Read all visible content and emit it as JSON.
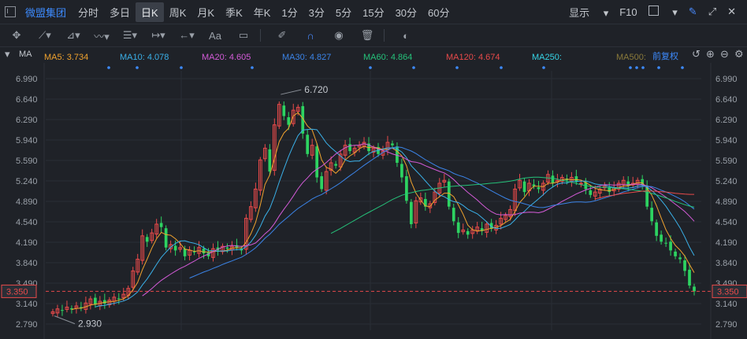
{
  "toolbar": {
    "stock_name": "微盟集团",
    "periods": [
      "分时",
      "多日",
      "日K",
      "周K",
      "月K",
      "季K",
      "年K",
      "1分",
      "3分",
      "5分",
      "15分",
      "30分",
      "60分"
    ],
    "active_period": "日K",
    "display_label": "显示",
    "f10_label": "F10"
  },
  "drawing_tools": [
    "move-icon",
    "line-icon",
    "ray-icon",
    "fib-icon",
    "wave-icon",
    "channel-icon",
    "range-icon",
    "arrow-icon",
    "text-icon",
    "note-icon",
    "eraser-icon",
    "magnet-icon",
    "eye-icon",
    "trash-icon",
    "toggle-icon"
  ],
  "text_tool_label": "Aa",
  "indicator_bar": {
    "name": "MA",
    "items": [
      {
        "label": "MA5: 3.734",
        "color": "#f0a22e"
      },
      {
        "label": "MA10: 4.078",
        "color": "#3ab0e8"
      },
      {
        "label": "MA20: 4.605",
        "color": "#d45bd8"
      },
      {
        "label": "MA30: 4.827",
        "color": "#3b84e8"
      },
      {
        "label": "MA60: 4.864",
        "color": "#25c27a"
      },
      {
        "label": "MA120: 4.674",
        "color": "#e84a4a"
      },
      {
        "label": "MA250:",
        "color": "#36d4e6"
      },
      {
        "label": "MA500:",
        "color": "#8a7a3a"
      }
    ],
    "adjust_label": "前复权"
  },
  "colors": {
    "up": "#e84a4a",
    "down": "#2dd361",
    "grid": "#2a2e36",
    "axis_text": "#9aa0a8",
    "current": "#e84a4a"
  },
  "chart_data": {
    "type": "candlestick",
    "ylim": [
      2.79,
      6.99
    ],
    "y_ticks": [
      2.79,
      3.14,
      3.49,
      3.84,
      4.19,
      4.54,
      4.89,
      5.24,
      5.59,
      5.94,
      6.29,
      6.64,
      6.99
    ],
    "y_tick_labels": [
      "2.790",
      "3.140",
      "3.490",
      "3.840",
      "4.190",
      "4.540",
      "4.890",
      "5.240",
      "5.590",
      "5.940",
      "6.290",
      "6.640",
      "6.990"
    ],
    "current_price": 3.35,
    "current_price_label": "3.350",
    "annotations": [
      {
        "text": "6.720",
        "value": 6.72
      },
      {
        "text": "2.930",
        "value": 2.93
      }
    ],
    "closes": [
      3.0,
      3.05,
      3.02,
      3.08,
      3.04,
      3.1,
      3.06,
      3.15,
      3.22,
      3.12,
      3.18,
      3.14,
      3.2,
      3.25,
      3.22,
      3.3,
      3.4,
      3.7,
      3.9,
      4.3,
      4.2,
      4.35,
      4.5,
      4.45,
      4.1,
      4.15,
      4.05,
      4.1,
      3.95,
      4.05,
      4.02,
      4.1,
      4.0,
      3.95,
      4.08,
      4.05,
      4.12,
      4.08,
      4.12,
      4.1,
      4.05,
      4.6,
      4.8,
      5.1,
      5.6,
      5.8,
      5.4,
      6.2,
      6.55,
      6.35,
      6.2,
      6.45,
      6.5,
      6.05,
      5.7,
      5.85,
      5.3,
      5.1,
      5.4,
      5.55,
      5.5,
      5.7,
      5.85,
      5.75,
      5.8,
      5.85,
      5.9,
      5.75,
      5.8,
      5.7,
      5.75,
      5.9,
      5.85,
      5.55,
      5.3,
      4.9,
      4.5,
      4.9,
      4.95,
      4.8,
      4.85,
      5.05,
      5.2,
      5.25,
      4.8,
      4.55,
      4.35,
      4.4,
      4.32,
      4.4,
      4.45,
      4.38,
      4.5,
      4.42,
      4.48,
      4.6,
      4.65,
      4.75,
      5.1,
      5.25,
      5.05,
      5.2,
      5.15,
      5.1,
      5.2,
      5.35,
      5.2,
      5.25,
      5.3,
      5.25,
      5.3,
      5.22,
      5.2,
      5.1,
      5.0,
      5.05,
      5.1,
      5.15,
      5.05,
      5.12,
      5.2,
      5.25,
      5.15,
      5.2,
      5.25,
      5.18,
      4.8,
      4.55,
      4.3,
      4.2,
      4.18,
      4.05,
      3.95,
      3.9,
      3.7,
      3.45,
      3.35
    ]
  }
}
